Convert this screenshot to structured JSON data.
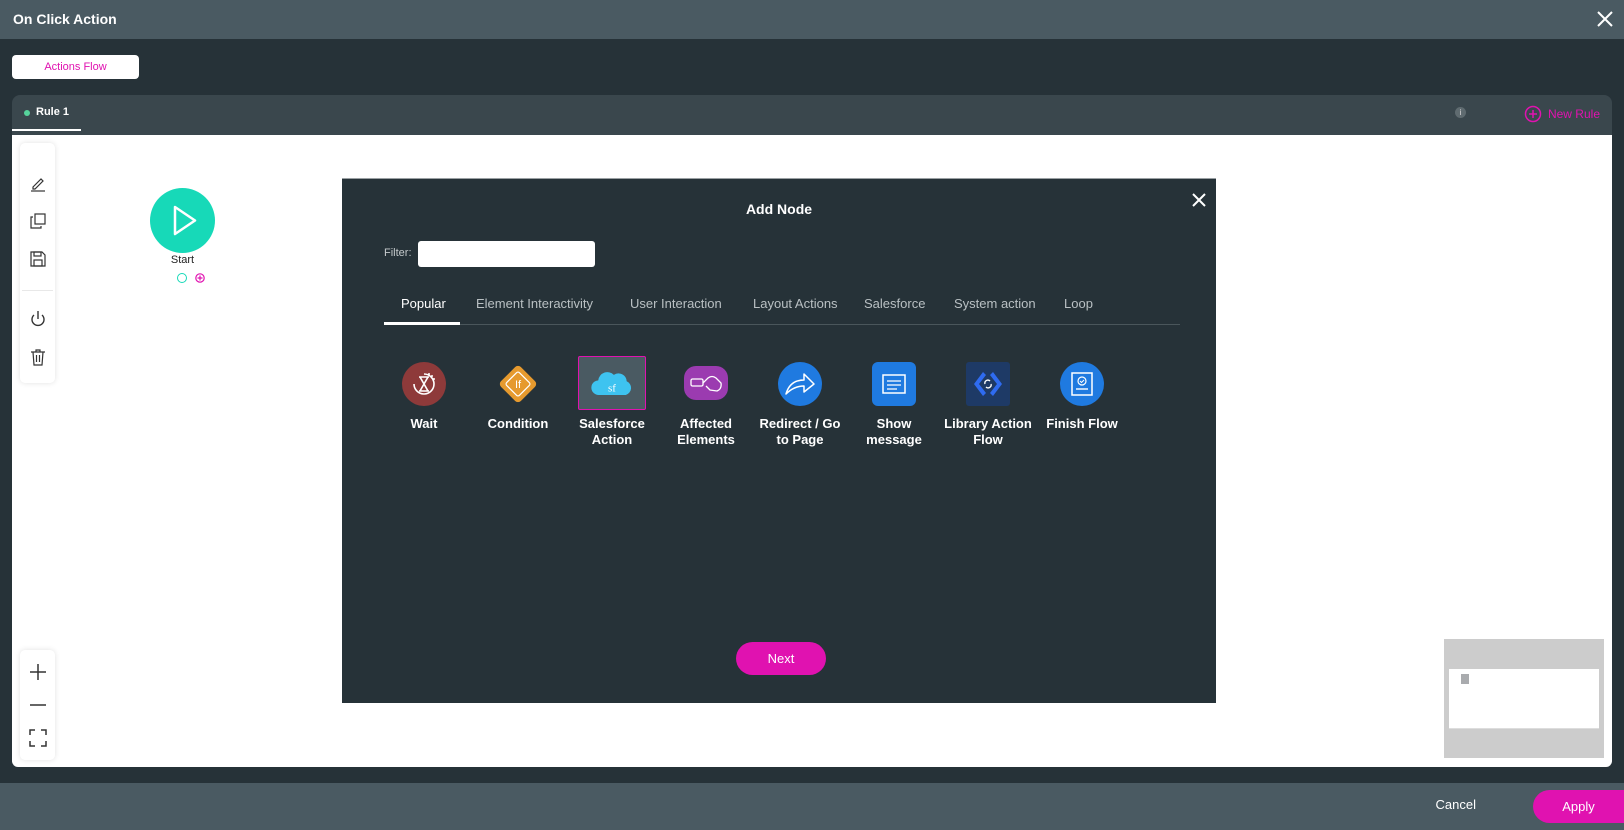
{
  "window": {
    "title": "On Click Action"
  },
  "flow_tab": {
    "label": "Actions Flow"
  },
  "rules": {
    "tabs": [
      {
        "label": "Rule 1",
        "active": true
      }
    ],
    "info_badge": "i",
    "new_rule_label": "New Rule"
  },
  "canvas": {
    "start_node": {
      "label": "Start"
    },
    "toolbar": [
      "edit",
      "duplicate",
      "save",
      "power",
      "delete"
    ],
    "zoom_controls": [
      "zoom-in",
      "zoom-out",
      "fit-view"
    ]
  },
  "modal": {
    "title": "Add Node",
    "filter": {
      "label": "Filter:",
      "value": "",
      "placeholder": ""
    },
    "tabs": [
      {
        "label": "Popular",
        "active": true
      },
      {
        "label": "Element Interactivity"
      },
      {
        "label": "User Interaction"
      },
      {
        "label": "Layout Actions"
      },
      {
        "label": "Salesforce"
      },
      {
        "label": "System action"
      },
      {
        "label": "Loop"
      }
    ],
    "nodes": [
      {
        "label": "Wait",
        "icon": "hourglass-icon",
        "color": "#8e3a3a"
      },
      {
        "label": "Condition",
        "icon": "condition-if-icon",
        "color": "#e69a2e"
      },
      {
        "label": "Salesforce Action",
        "icon": "salesforce-cloud-icon",
        "color": "#3ec3f0",
        "selected": true
      },
      {
        "label": "Affected Elements",
        "icon": "pointer-hand-icon",
        "color": "#9b3bb0"
      },
      {
        "label": "Redirect / Go to Page",
        "icon": "redirect-arrow-icon",
        "color": "#1f7ae0"
      },
      {
        "label": "Show message",
        "icon": "message-icon",
        "color": "#1f7ae0"
      },
      {
        "label": "Library Action Flow",
        "icon": "library-code-icon",
        "color": "#1e3a66"
      },
      {
        "label": "Finish Flow",
        "icon": "finish-flag-icon",
        "color": "#1f7ae0"
      }
    ],
    "next_label": "Next"
  },
  "footer": {
    "cancel_label": "Cancel",
    "apply_label": "Apply"
  },
  "colors": {
    "accent": "#e012b0",
    "start": "#17d9b8",
    "dark": "#263238",
    "bar": "#4a5a62"
  }
}
